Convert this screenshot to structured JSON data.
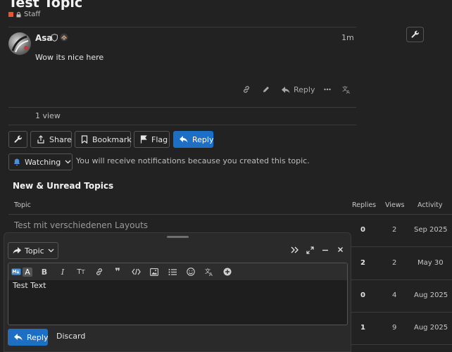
{
  "topic": {
    "title": "Test Topic",
    "category": "Staff",
    "category_color": "#e45735"
  },
  "post": {
    "username": "Asa",
    "time": "1m",
    "body": "Wow its nice here",
    "reply_label": "Reply",
    "views": "1 view"
  },
  "footer_buttons": {
    "share": "Share",
    "bookmark": "Bookmark",
    "flag": "Flag",
    "reply": "Reply"
  },
  "notifications": {
    "level": "Watching",
    "notice": "You will receive notifications because you created this topic."
  },
  "suggested": {
    "heading": "New & Unread Topics",
    "columns": {
      "topic": "Topic",
      "replies": "Replies",
      "views": "Views",
      "activity": "Activity"
    },
    "rows": [
      {
        "title": "Test mit verschiedenen Layouts",
        "replies": "0",
        "views": "2",
        "activity": "Sep 2025"
      },
      {
        "title": "",
        "replies": "2",
        "views": "2",
        "activity": "May 30"
      },
      {
        "title": "",
        "replies": "0",
        "views": "4",
        "activity": "Aug 2025"
      },
      {
        "title": "",
        "replies": "1",
        "views": "9",
        "activity": "Aug 2025"
      }
    ]
  },
  "composer": {
    "action": "Topic",
    "text": "Test Text",
    "submit": "Reply",
    "discard": "Discard"
  },
  "colors": {
    "accent": "#1e6fc4",
    "background": "#222222"
  }
}
